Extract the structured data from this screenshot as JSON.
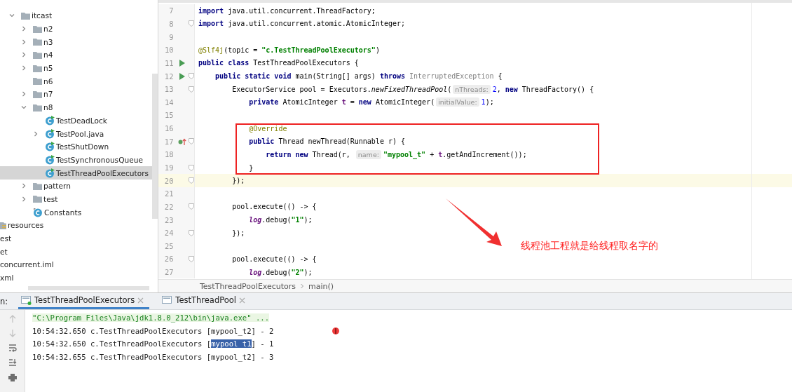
{
  "project_tree": {
    "items": [
      {
        "label": "itcast",
        "kind": "package",
        "expanded": true,
        "selected": false,
        "children": [
          {
            "label": "n2",
            "kind": "package",
            "expanded": false,
            "selected": false
          },
          {
            "label": "n3",
            "kind": "package",
            "expanded": false,
            "selected": false
          },
          {
            "label": "n4",
            "kind": "package",
            "expanded": false,
            "selected": false
          },
          {
            "label": "n5",
            "kind": "package",
            "expanded": false,
            "selected": false
          },
          {
            "label": "n6",
            "kind": "package",
            "selected": false
          },
          {
            "label": "n7",
            "kind": "package",
            "expanded": false,
            "selected": false
          },
          {
            "label": "n8",
            "kind": "package",
            "expanded": true,
            "selected": false,
            "children": [
              {
                "label": "TestDeadLock",
                "kind": "runnable-class",
                "selected": false
              },
              {
                "label": "TestPool.java",
                "kind": "runnable-class",
                "expanded": false,
                "selected": false
              },
              {
                "label": "TestShutDown",
                "kind": "runnable-class",
                "selected": false
              },
              {
                "label": "TestSynchronousQueue",
                "kind": "runnable-class",
                "selected": false
              },
              {
                "label": "TestThreadPoolExecutors",
                "kind": "runnable-class",
                "selected": true
              }
            ]
          },
          {
            "label": "pattern",
            "kind": "package",
            "expanded": false,
            "selected": false
          },
          {
            "label": "test",
            "kind": "package",
            "expanded": false,
            "selected": false
          },
          {
            "label": "Constants",
            "kind": "class",
            "selected": false
          }
        ]
      }
    ],
    "files": [
      {
        "label": "resources",
        "kind": "resources",
        "selected": false
      },
      {
        "label": "est",
        "kind": "plain",
        "selected": false
      },
      {
        "label": "et",
        "kind": "plain",
        "selected": false
      },
      {
        "label": "concurrent.iml",
        "kind": "plain",
        "selected": false
      },
      {
        "label": "xml",
        "kind": "plain",
        "selected": false
      }
    ]
  },
  "editor": {
    "lines": [
      {
        "number": "7",
        "tokens": [
          {
            "text": "import",
            "kind": "kw"
          },
          {
            "text": " java.util.concurrent.ThreadFactory;",
            "kind": "plain"
          }
        ]
      },
      {
        "number": "8",
        "fold": true,
        "tokens": [
          {
            "text": "import",
            "kind": "kw"
          },
          {
            "text": " java.util.concurrent.atomic.AtomicInteger;",
            "kind": "plain"
          }
        ]
      },
      {
        "number": "9"
      },
      {
        "number": "10",
        "tokens": [
          {
            "text": "@Slf4j",
            "kind": "ann"
          },
          {
            "text": "(topic = ",
            "kind": "plain"
          },
          {
            "text": "\"c.TestThreadPoolExecutors\"",
            "kind": "str"
          },
          {
            "text": ")",
            "kind": "plain"
          }
        ]
      },
      {
        "number": "11",
        "runnable": true,
        "tokens": [
          {
            "text": "public class",
            "kind": "kw"
          },
          {
            "text": " TestThreadPoolExecutors {",
            "kind": "plain"
          }
        ]
      },
      {
        "number": "12",
        "runnable": true,
        "fold": true,
        "tokens": [
          {
            "text": "    public static void",
            "kind": "kw"
          },
          {
            "text": " main(String[] args) ",
            "kind": "plain"
          },
          {
            "text": "throws ",
            "kind": "kw"
          },
          {
            "text": "InterruptedException",
            "kind": "dim"
          },
          {
            "text": " {",
            "kind": "plain"
          }
        ]
      },
      {
        "number": "13",
        "fold": true,
        "tokens": [
          {
            "text": "        ExecutorService pool = Executors.",
            "kind": "plain"
          },
          {
            "text": "newFixedThreadPool",
            "kind": "italic"
          },
          {
            "text": "(",
            "kind": "plain"
          },
          {
            "text": "nThreads:",
            "kind": "hint"
          },
          {
            "text": "2",
            "kind": "num"
          },
          {
            "text": ", ",
            "kind": "plain"
          },
          {
            "text": "new",
            "kind": "kw"
          },
          {
            "text": " ThreadFactory() {",
            "kind": "plain"
          }
        ]
      },
      {
        "number": "14",
        "tokens": [
          {
            "text": "            private",
            "kind": "kw"
          },
          {
            "text": " AtomicInteger ",
            "kind": "plain"
          },
          {
            "text": "t",
            "kind": "field"
          },
          {
            "text": " = ",
            "kind": "plain"
          },
          {
            "text": "new",
            "kind": "kw"
          },
          {
            "text": " AtomicInteger(",
            "kind": "plain"
          },
          {
            "text": "initialValue:",
            "kind": "hint"
          },
          {
            "text": "1",
            "kind": "num"
          },
          {
            "text": ");",
            "kind": "plain"
          }
        ]
      },
      {
        "number": "15"
      },
      {
        "number": "16",
        "tokens": [
          {
            "text": "            @Override",
            "kind": "ann"
          }
        ]
      },
      {
        "number": "17",
        "overrides": true,
        "fold": true,
        "tokens": [
          {
            "text": "            public",
            "kind": "kw"
          },
          {
            "text": " Thread newThread(Runnable r) {",
            "kind": "plain"
          }
        ]
      },
      {
        "number": "18",
        "tokens": [
          {
            "text": "                return new",
            "kind": "kw"
          },
          {
            "text": " Thread(r, ",
            "kind": "plain"
          },
          {
            "text": "name:",
            "kind": "hint"
          },
          {
            "text": "\"mypool_t\"",
            "kind": "str"
          },
          {
            "text": " + ",
            "kind": "plain"
          },
          {
            "text": "t",
            "kind": "field"
          },
          {
            "text": ".getAndIncrement());",
            "kind": "plain"
          }
        ]
      },
      {
        "number": "19",
        "fold": true,
        "tokens": [
          {
            "text": "            }",
            "kind": "plain"
          }
        ]
      },
      {
        "number": "20",
        "fold": true,
        "current": true,
        "tokens": [
          {
            "text": "        });",
            "kind": "plain"
          }
        ]
      },
      {
        "number": "21"
      },
      {
        "number": "22",
        "fold": true,
        "tokens": [
          {
            "text": "        pool.execute(() -> {",
            "kind": "plain"
          }
        ]
      },
      {
        "number": "23",
        "tokens": [
          {
            "text": "            log",
            "kind": "static"
          },
          {
            "text": ".debug(",
            "kind": "plain"
          },
          {
            "text": "\"1\"",
            "kind": "str"
          },
          {
            "text": ");",
            "kind": "plain"
          }
        ]
      },
      {
        "number": "24",
        "fold": true,
        "tokens": [
          {
            "text": "        });",
            "kind": "plain"
          }
        ]
      },
      {
        "number": "25"
      },
      {
        "number": "26",
        "fold": true,
        "tokens": [
          {
            "text": "        pool.execute(() -> {",
            "kind": "plain"
          }
        ]
      },
      {
        "number": "27",
        "tokens": [
          {
            "text": "            log",
            "kind": "static"
          },
          {
            "text": ".debug(",
            "kind": "plain"
          },
          {
            "text": "\"2\"",
            "kind": "str"
          },
          {
            "text": ");",
            "kind": "plain"
          }
        ]
      }
    ],
    "annotation": {
      "text": "线程池工程就是给线程取名字的"
    },
    "breadcrumbs": [
      "TestThreadPoolExecutors",
      "main()"
    ]
  },
  "run_panel": {
    "label": "n:",
    "tabs": [
      {
        "label": "TestThreadPoolExecutors",
        "selected": true,
        "running": true
      },
      {
        "label": "TestThreadPool",
        "selected": false,
        "running": false
      }
    ],
    "console": [
      {
        "kind": "command",
        "parts": [
          {
            "text": "\"C:\\Program Files\\Java\\jdk1.8.0_212\\bin\\java.exe\" ...",
            "selected": false
          }
        ]
      },
      {
        "kind": "log",
        "parts": [
          {
            "text": "10:54:32.650 c.TestThreadPoolExecutors [mypool_t2] - 2",
            "selected": false
          }
        ]
      },
      {
        "kind": "log",
        "parts": [
          {
            "text": "10:54:32.650 c.TestThreadPoolExecutors [",
            "selected": false
          },
          {
            "text": "mypool_t1",
            "selected": true
          },
          {
            "text": "] - 1",
            "selected": false
          }
        ]
      },
      {
        "kind": "log",
        "parts": [
          {
            "text": "10:54:32.655 c.TestThreadPoolExecutors [mypool_t2] - 3",
            "selected": false
          }
        ]
      }
    ]
  }
}
